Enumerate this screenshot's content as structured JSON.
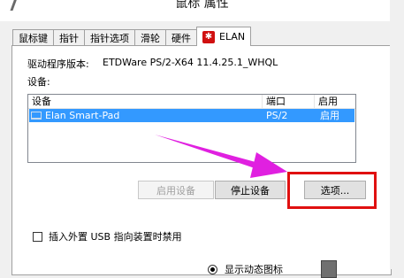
{
  "window": {
    "title": "鼠标 属性"
  },
  "tabs": [
    {
      "label": "鼠标键"
    },
    {
      "label": "指针"
    },
    {
      "label": "指针选项"
    },
    {
      "label": "滑轮"
    },
    {
      "label": "硬件"
    },
    {
      "label": "ELAN"
    }
  ],
  "driver": {
    "label": "驱动程序版本:",
    "value": "ETDWare PS/2-X64 11.4.25.1_WHQL"
  },
  "devices": {
    "label": "设备:",
    "columns": [
      "设备",
      "端口",
      "启用"
    ],
    "rows": [
      {
        "name": "Elan Smart-Pad",
        "port": "PS/2",
        "enabled": "启用"
      }
    ]
  },
  "buttons": {
    "enable": "启用设备",
    "stop": "停止设备",
    "options": "选项..."
  },
  "checkbox": {
    "label": "插入外置 USB 指向装置时禁用"
  },
  "radio": {
    "label": "显示动态图标"
  },
  "colors": {
    "selection": "#3399ff",
    "highlight_box": "#e01010",
    "arrow": "#e020e0"
  }
}
